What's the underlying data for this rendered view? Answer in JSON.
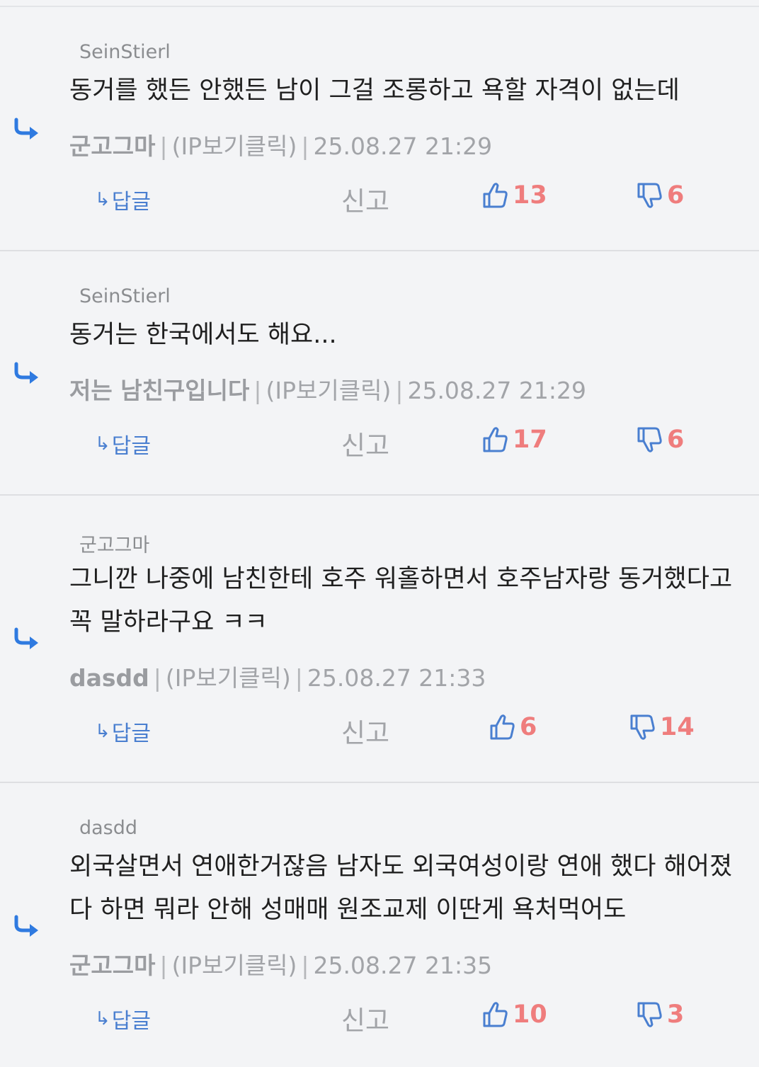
{
  "labels": {
    "reply": "답글",
    "report": "신고",
    "ip": "(IP보기클릭)"
  },
  "comments": [
    {
      "parent_author": "SeinStierl",
      "text": "동거를 했든 안했든 남이 그걸 조롱하고 욕할 자격이 없는데",
      "author": "군고그마",
      "timestamp": "25.08.27 21:29",
      "likes": "13",
      "dislikes": "6"
    },
    {
      "parent_author": "SeinStierl",
      "text": "동거는 한국에서도 해요...",
      "author": "저는 남친구입니다",
      "timestamp": "25.08.27 21:29",
      "likes": "17",
      "dislikes": "6"
    },
    {
      "parent_author": "군고그마",
      "text": "그니깐 나중에 남친한테 호주 워홀하면서 호주남자랑 동거했다고 꼭 말하라구요 ㅋㅋ",
      "author": "dasdd",
      "timestamp": "25.08.27 21:33",
      "likes": "6",
      "dislikes": "14"
    },
    {
      "parent_author": "dasdd",
      "text": "외국살면서 연애한거잖음 남자도 외국여성이랑 연애 했다 해어졌다 하면 뭐라 안해 성매매 원조교제 이딴게 욕처먹어도",
      "author": "군고그마",
      "timestamp": "25.08.27 21:35",
      "likes": "10",
      "dislikes": "3"
    }
  ],
  "colors": {
    "background": "#f3f4f6",
    "accent": "#2f7ae0",
    "vote_count": "#ef7d7d",
    "muted": "#a2a4a8"
  },
  "icons": [
    "reply-arrow-icon",
    "thumbs-up-icon",
    "thumbs-down-icon"
  ]
}
